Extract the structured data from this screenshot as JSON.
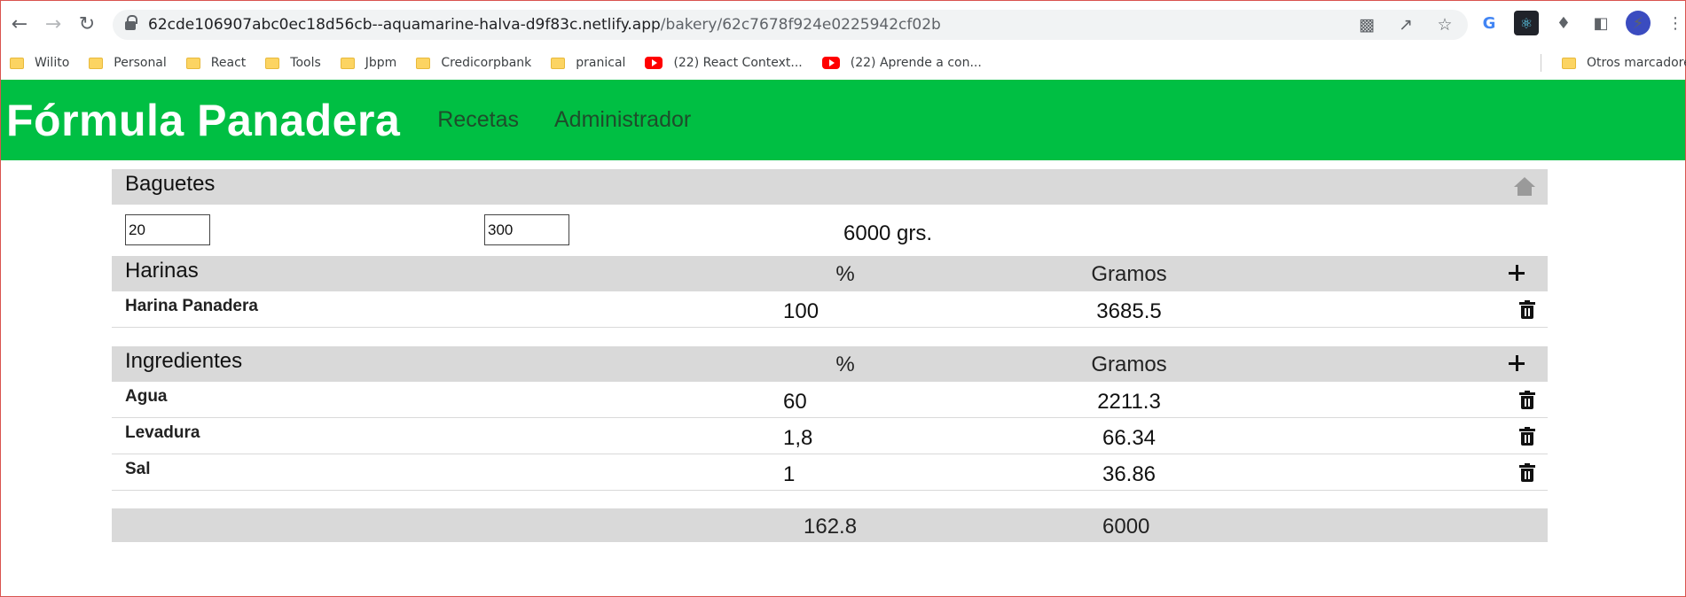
{
  "browser": {
    "url_host": "62cde106907abc0ec18d56cb--aquamarine-halva-d9f83c.netlify.app",
    "url_path": "/bakery/62c7678f924e0225942cf02b",
    "bookmarks": [
      {
        "label": "Wilito",
        "type": "folder"
      },
      {
        "label": "Personal",
        "type": "folder"
      },
      {
        "label": "React",
        "type": "folder"
      },
      {
        "label": "Tools",
        "type": "folder"
      },
      {
        "label": "Jbpm",
        "type": "folder"
      },
      {
        "label": "Credicorpbank",
        "type": "folder"
      },
      {
        "label": "pranical",
        "type": "folder"
      },
      {
        "label": "(22) React Context...",
        "type": "youtube"
      },
      {
        "label": "(22) Aprende a con...",
        "type": "youtube"
      }
    ],
    "other_bookmarks": "Otros marcadores"
  },
  "app": {
    "brand": "Fórmula Panadera",
    "nav": [
      "Recetas",
      "Administrador"
    ],
    "accent_color": "#00bf43"
  },
  "recipe": {
    "title": "Baguetes",
    "quantity_value": "20",
    "weight_value": "300",
    "total_weight": "6000 grs.",
    "flours": {
      "header": "Harinas",
      "col_pct": "%",
      "col_grams": "Gramos",
      "rows": [
        {
          "name": "Harina Panadera",
          "pct": "100",
          "grams": "3685.5"
        }
      ]
    },
    "ingredients": {
      "header": "Ingredientes",
      "col_pct": "%",
      "col_grams": "Gramos",
      "rows": [
        {
          "name": "Agua",
          "pct": "60",
          "grams": "2211.3"
        },
        {
          "name": "Levadura",
          "pct": "1,8",
          "grams": "66.34"
        },
        {
          "name": "Sal",
          "pct": "1",
          "grams": "36.86"
        }
      ]
    },
    "totals": {
      "pct": "162.8",
      "grams": "6000"
    }
  }
}
